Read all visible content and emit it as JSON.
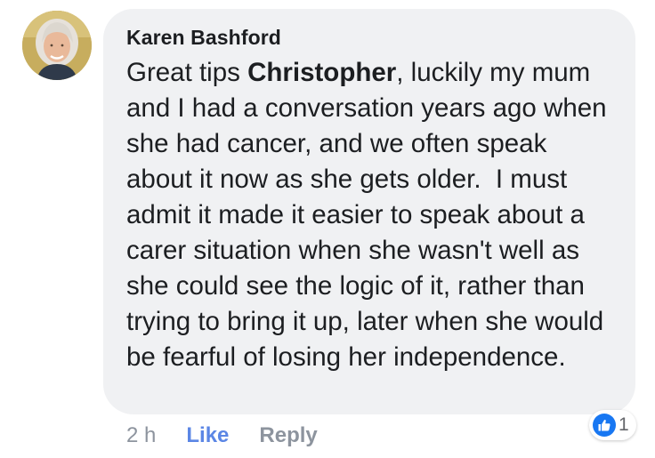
{
  "comment": {
    "author": "Karen Bashford",
    "text_before_mention": "Great tips ",
    "mention": "Christopher",
    "text_after_mention": ", luckily my mum and I had a conversation years ago when she had cancer, and we often speak about it now as she gets older.  I must admit it made it easier to speak about a carer situation when she wasn't well as she could see the logic of it, rather than trying to bring it up, later when she would be fearful of losing her independence.",
    "timestamp": "2 h",
    "like_label": "Like",
    "reply_label": "Reply",
    "reaction_count": "1",
    "reaction_icon": "thumbs-up-icon"
  },
  "colors": {
    "bubble_bg": "#f0f1f3",
    "like_link": "#5b86e5",
    "meta_text": "#8d949e",
    "like_badge": "#1877f2"
  }
}
